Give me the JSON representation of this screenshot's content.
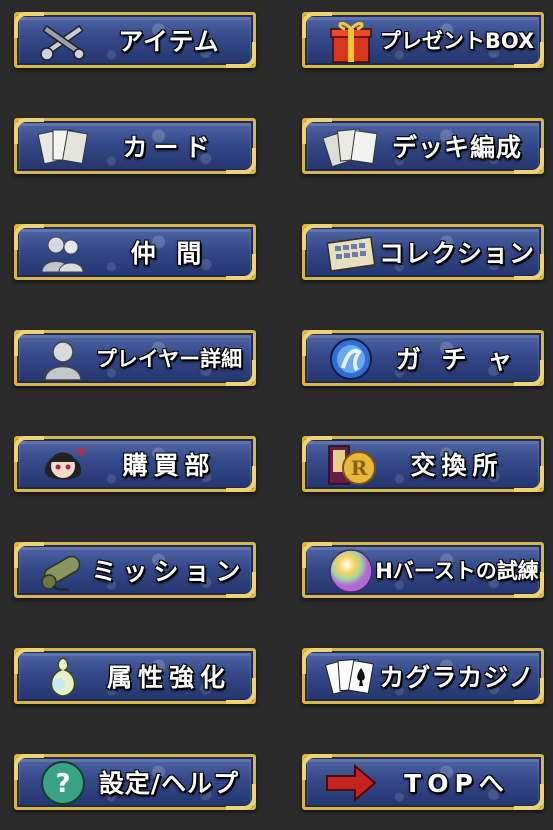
{
  "menu": {
    "items": [
      {
        "label": "アイテム",
        "icon": "weapons-icon"
      },
      {
        "label": "プレゼントBOX",
        "icon": "present-box-icon"
      },
      {
        "label": "カード",
        "icon": "cards-icon"
      },
      {
        "label": "デッキ編成",
        "icon": "deck-cards-icon"
      },
      {
        "label": "仲 間",
        "icon": "friends-icon"
      },
      {
        "label": "コレクション",
        "icon": "collection-album-icon"
      },
      {
        "label": "プレイヤー詳細",
        "icon": "player-icon"
      },
      {
        "label": "ガ チ ャ",
        "icon": "gacha-orb-icon"
      },
      {
        "label": "購買部",
        "icon": "shop-girl-icon"
      },
      {
        "label": "交換所",
        "icon": "exchange-coin-icon"
      },
      {
        "label": "ミッション",
        "icon": "scroll-icon"
      },
      {
        "label": "Hバーストの試練",
        "icon": "burst-orb-icon"
      },
      {
        "label": "属性強化",
        "icon": "gourd-icon"
      },
      {
        "label": "カグラカジノ",
        "icon": "playing-cards-icon"
      },
      {
        "label": "設定/ヘルプ",
        "icon": "help-icon"
      },
      {
        "label": "TOPへ",
        "icon": "arrow-right-icon"
      }
    ]
  },
  "colors": {
    "background": "#2b2b2b",
    "button_blue": "#35498a",
    "frame_gold": "#d8b64a"
  }
}
